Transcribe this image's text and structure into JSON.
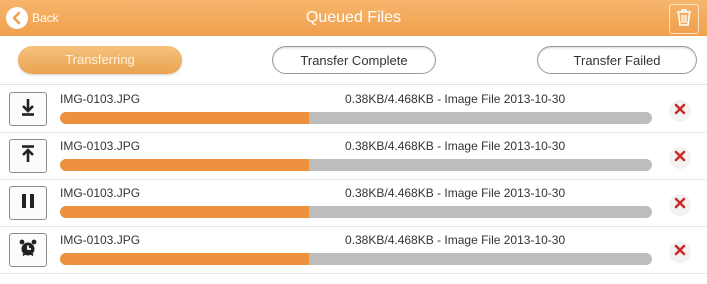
{
  "header": {
    "back_label": "Back",
    "title": "Queued Files",
    "back_icon": "back-arrow-icon",
    "trash_icon": "trash-icon"
  },
  "tabs": [
    {
      "label": "Transferring",
      "active": true
    },
    {
      "label": "Transfer Complete",
      "active": false
    },
    {
      "label": "Transfer Failed",
      "active": false
    }
  ],
  "items": [
    {
      "action_icon": "download-icon",
      "file_name": "IMG-0103.JPG",
      "meta": "0.38KB/4.468KB - Image File 2013-10-30",
      "progress_fraction": 0.42
    },
    {
      "action_icon": "upload-icon",
      "file_name": "IMG-0103.JPG",
      "meta": "0.38KB/4.468KB - Image File 2013-10-30",
      "progress_fraction": 0.42
    },
    {
      "action_icon": "pause-icon",
      "file_name": "IMG-0103.JPG",
      "meta": "0.38KB/4.468KB - Image File 2013-10-30",
      "progress_fraction": 0.42
    },
    {
      "action_icon": "alarm-clock-icon",
      "file_name": "IMG-0103.JPG",
      "meta": "0.38KB/4.468KB - Image File 2013-10-30",
      "progress_fraction": 0.42
    }
  ],
  "colors": {
    "accent": "#f0a04d",
    "progress_fill": "#ee913e",
    "progress_track": "#bdbdbd",
    "remove_icon": "#cc2b2b"
  }
}
